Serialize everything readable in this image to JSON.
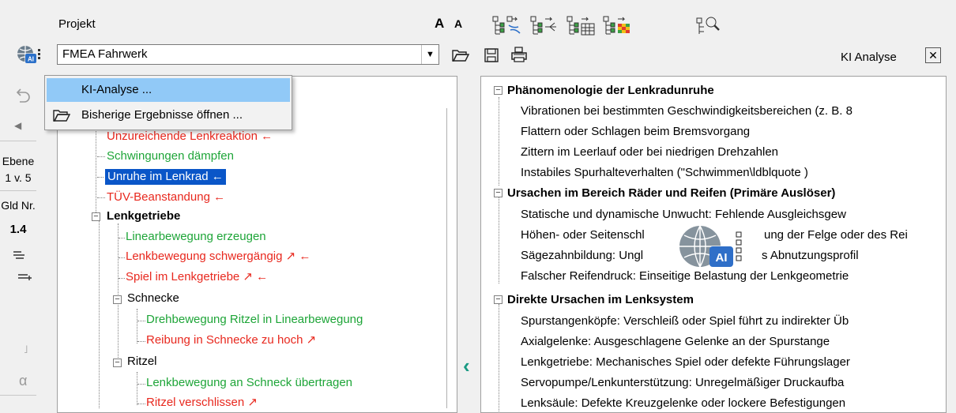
{
  "header": {
    "project_label": "Projekt",
    "project_value": "FMEA Fahrwerk",
    "ki_panel_title": "KI Analyse"
  },
  "toolbar": {
    "font_increase": "A",
    "font_decrease": "A"
  },
  "left_strip": {
    "ebene_label": "Ebene",
    "ebene_value": "1 v. 5",
    "gld_label": "Gld Nr.",
    "gld_value": "1.4",
    "alpha": "α",
    "hook": "˩"
  },
  "menu": {
    "items": [
      {
        "label": "KI-Analyse ..."
      },
      {
        "label": "Bisherige Ergebnisse öffnen ..."
      }
    ]
  },
  "tree": {
    "rows": [
      {
        "text": "Unzureichende Lenkreaktion ←"
      },
      {
        "text": "Schwingungen dämpfen"
      },
      {
        "text": "Unruhe im Lenkrad ←"
      },
      {
        "text": "TÜV-Beanstandung ←"
      },
      {
        "text": "Lenkgetriebe"
      },
      {
        "text": "Linearbewegung erzeugen"
      },
      {
        "text": "Lenkbewegung schwergängig ↗ ←"
      },
      {
        "text": "Spiel im Lenkgetriebe ↗ ←"
      },
      {
        "text": "Schnecke"
      },
      {
        "text": "Drehbewegung Ritzel in Linearbewegung"
      },
      {
        "text": "Reibung in Schnecke zu hoch ↗"
      },
      {
        "text": "Ritzel"
      },
      {
        "text": "Lenkbewegung an Schneck übertragen"
      },
      {
        "text": "Ritzel verschlissen ↗"
      }
    ]
  },
  "analysis": {
    "groups": [
      {
        "title": "Phänomenologie der Lenkradunruhe",
        "items": [
          "Vibrationen bei bestimmten Geschwindigkeitsbereichen (z. B. 8",
          "Flattern oder Schlagen beim Bremsvorgang",
          "Zittern im Leerlauf oder bei niedrigen Drehzahlen",
          "Instabiles Spurhalteverhalten (\"Schwimmen\\ldblquote )"
        ]
      },
      {
        "title": "Ursachen im Bereich Räder und Reifen (Primäre Auslöser)",
        "items": [
          "Statische und dynamische Unwucht: Fehlende Ausgleichsgew",
          "Höhen- oder Seitenschl",
          "Sägezahnbildung: Ungl",
          "Falscher Reifendruck: Einseitige Belastung der Lenkgeometrie"
        ],
        "hidden_tails": [
          "ung der Felge oder des Rei",
          "s Abnutzungsprofil"
        ]
      },
      {
        "title": "Direkte Ursachen im Lenksystem",
        "items": [
          "Spurstangenköpfe: Verschleiß oder Spiel führt zu indirekter Üb",
          "Axialgelenke: Ausgeschlagene Gelenke an der Spurstange",
          "Lenkgetriebe: Mechanisches Spiel oder defekte Führungslager",
          "Servopumpe/Lenkunterstützung: Unregelmäßiger Druckaufba",
          "Lenksäule: Defekte Kreuzgelenke oder lockere Befestigungen"
        ]
      }
    ],
    "ai_badge": "AI"
  },
  "icons": {
    "globe_ai": "globe-ai-icon",
    "undo": "undo-icon",
    "open": "folder-open-icon",
    "save": "save-icon",
    "print": "print-icon",
    "zoom": "tree-search-icon"
  },
  "colors": {
    "red": "#e8281e",
    "green": "#1ea538",
    "selection": "#0a56c8",
    "menu_highlight": "#91c9f7",
    "chevron": "#1a9a83"
  }
}
